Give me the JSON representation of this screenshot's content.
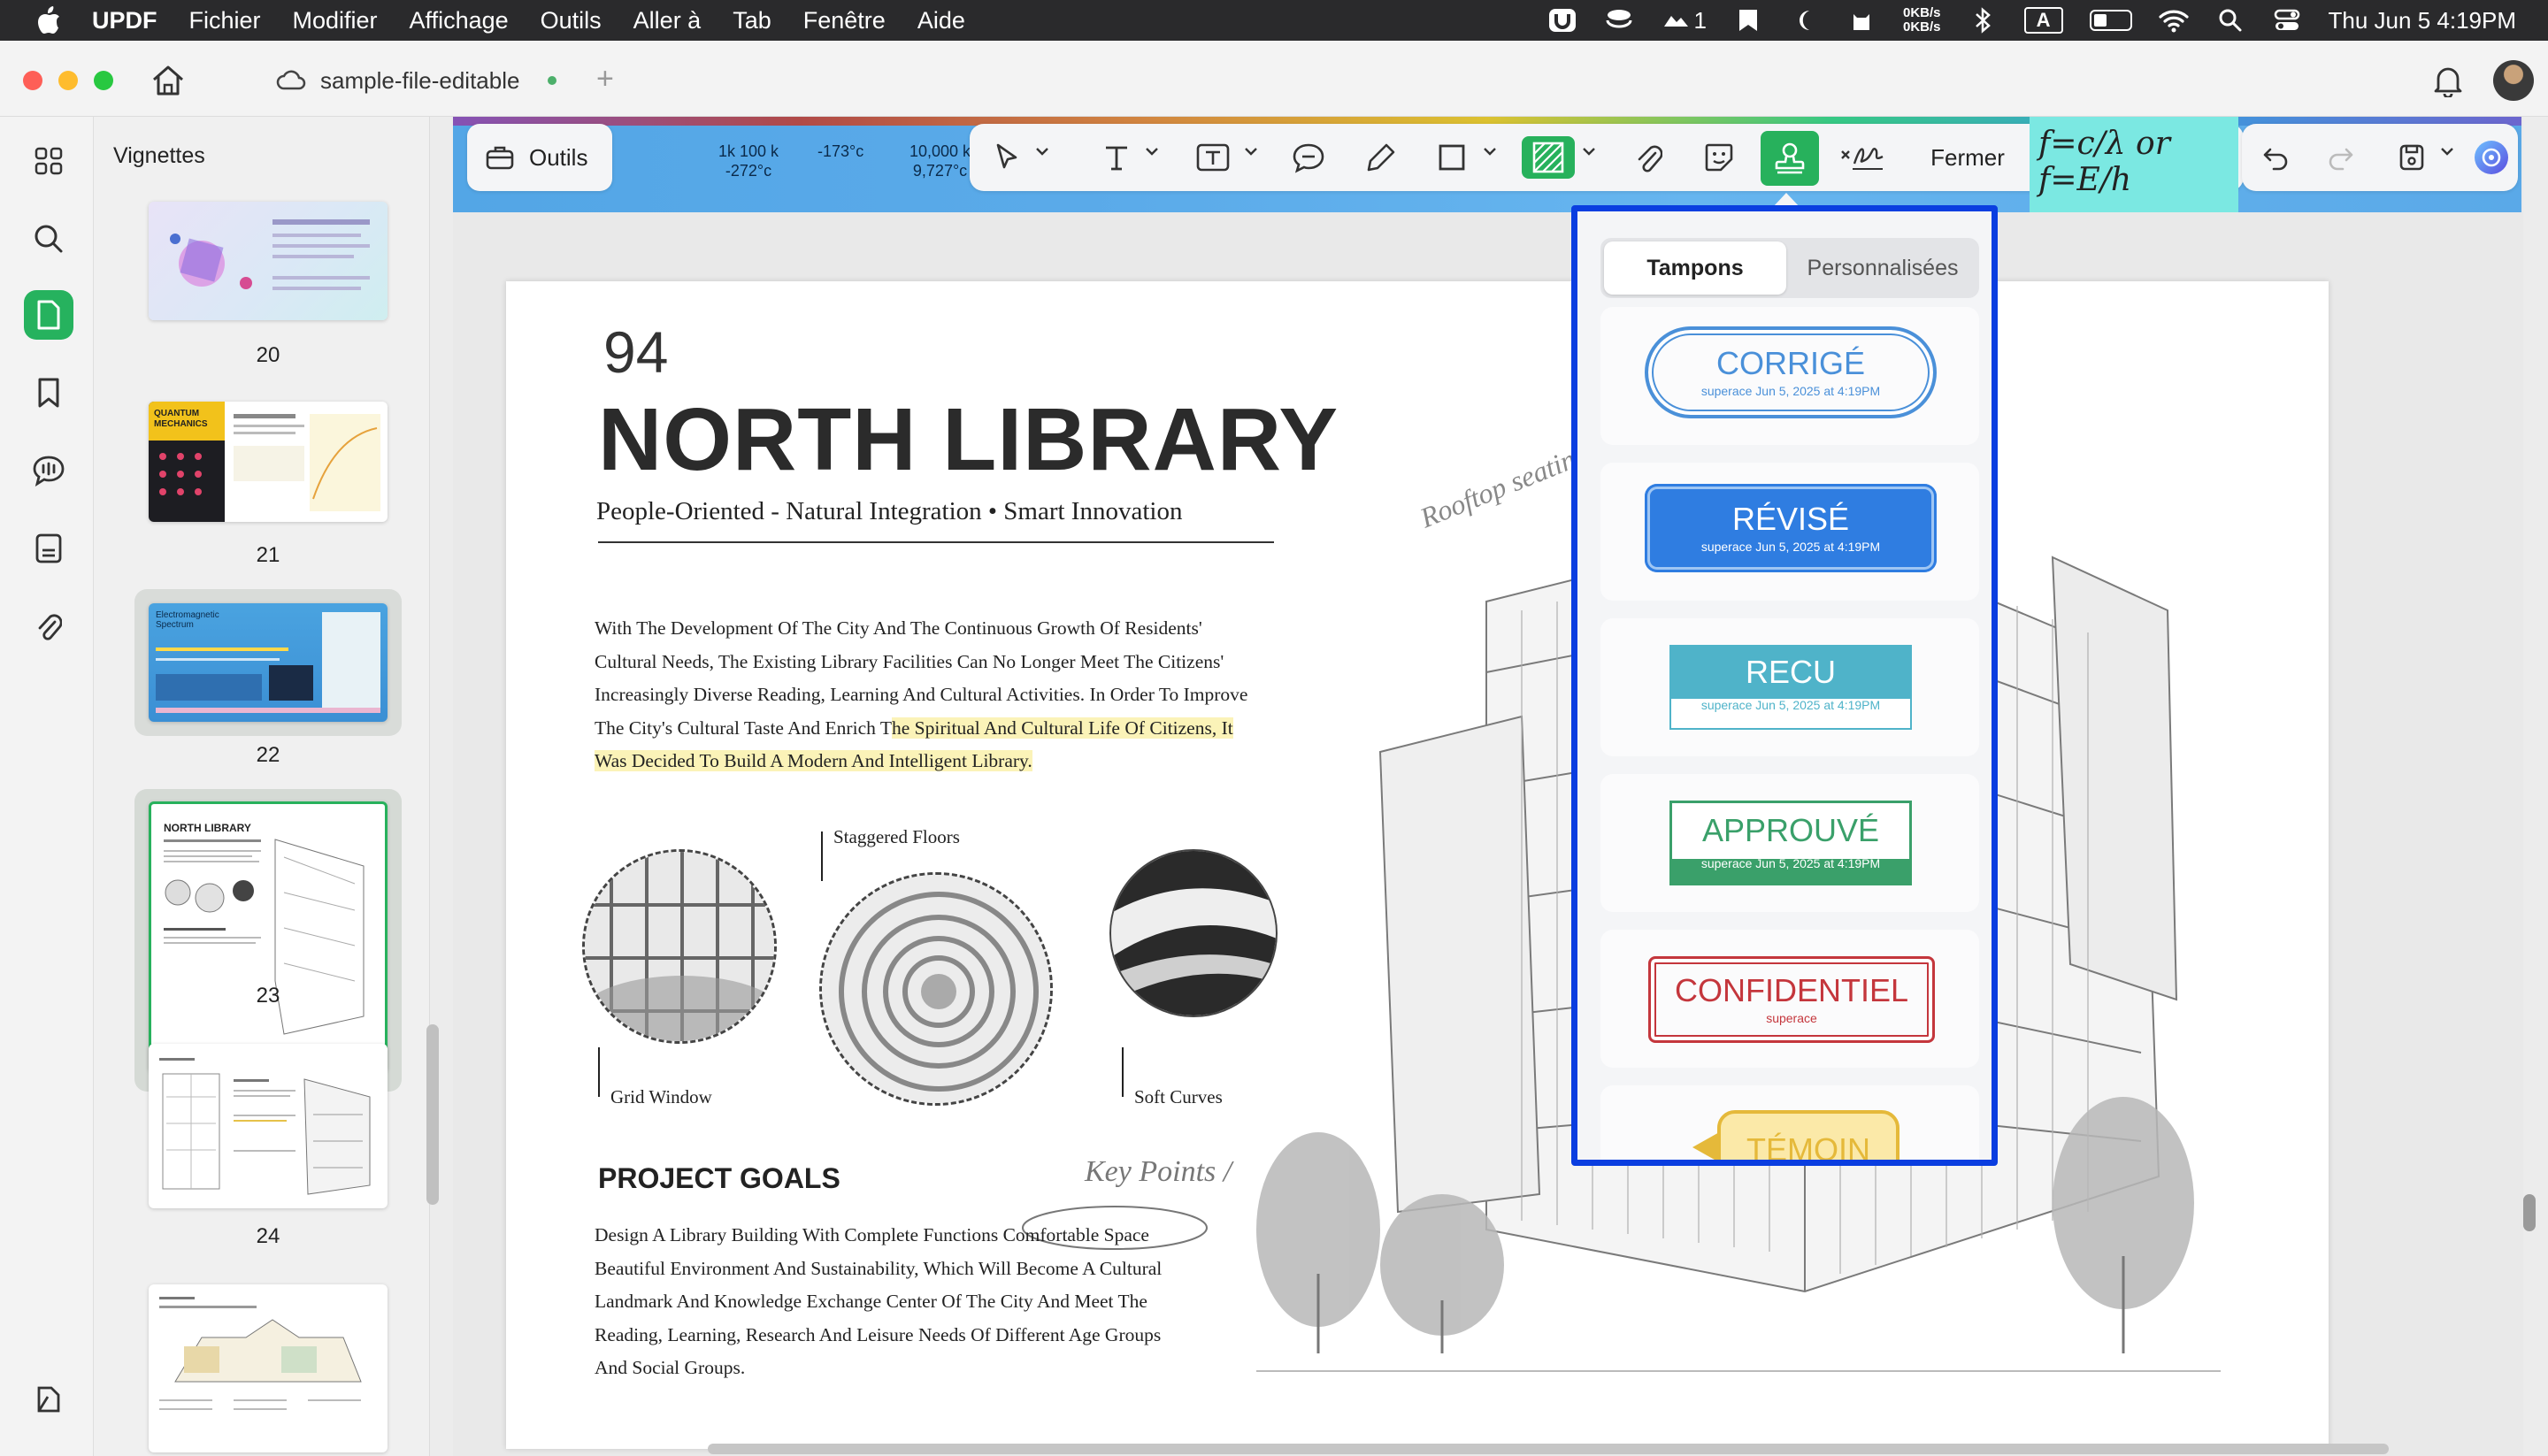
{
  "menubar": {
    "app": "UPDF",
    "items": [
      "Fichier",
      "Modifier",
      "Affichage",
      "Outils",
      "Aller à",
      "Tab",
      "Fenêtre",
      "Aide"
    ],
    "status": {
      "badge_count": "1",
      "net_up": "0KB/s",
      "net_down": "0KB/s",
      "input_source": "A",
      "datetime": "Thu Jun 5  4:19PM"
    }
  },
  "window": {
    "tab_title": "sample-file-editable",
    "add_tab": "+"
  },
  "sidebar": {
    "title": "Vignettes",
    "pages": [
      {
        "number": "20"
      },
      {
        "number": "21",
        "thumb_text": "QUANTUM MECHANICS"
      },
      {
        "number": "22",
        "thumb_text": "Electromagnetic Spectrum"
      },
      {
        "number": "23",
        "thumb_text": "NORTH LIBRARY",
        "selected": true
      },
      {
        "number": "24"
      }
    ]
  },
  "toolbar": {
    "outils_label": "Outils",
    "fermer_label": "Fermer",
    "strip_labels": [
      {
        "top": "1k 100 k",
        "bottom": "-272°c"
      },
      {
        "top": "",
        "bottom": "-173°c"
      },
      {
        "top": "10,000 k",
        "bottom": "9,727°c"
      }
    ],
    "formula": "f=c/λ or f=E/h"
  },
  "document": {
    "page_number": "94",
    "title": "NORTH LIBRARY",
    "subtitle": "People-Oriented - Natural Integration • Smart Innovation",
    "intro_lines": [
      "With The Development Of The City And The Continuous Growth Of Residents'",
      "Cultural Needs, The Existing Library Facilities Can No Longer Meet The Citizens'",
      "Increasingly Diverse Reading, Learning And Cultural Activities. In Order To Improve"
    ],
    "intro_line4_plain": "The City's Cultural Taste And Enrich T",
    "intro_line4_hl": "he Spiritual And Cultural Life Of Citizens, It",
    "intro_line5_hl": "Was Decided To Build A Modern And Intelligent Library.",
    "captions": {
      "grid": "Grid Window",
      "staggered": "Staggered Floors",
      "curves": "Soft Curves"
    },
    "rooftop": "Rooftop seatin",
    "goals_title": "PROJECT GOALS",
    "key_points": "Key Points /",
    "goals_lines": [
      "Design A Library Building With Complete Functions Comfortable Space",
      "Beautiful Environment And Sustainability, Which Will Become A Cultural",
      "Landmark And Knowledge Exchange Center Of The City And Meet The",
      "Reading, Learning, Research And Leisure Needs Of Different Age Groups",
      "And Social Groups."
    ]
  },
  "stamp_panel": {
    "tabs": [
      "Tampons",
      "Personnalisées"
    ],
    "active_tab": "Tampons",
    "stamps": [
      {
        "title": "CORRIGÉ",
        "sub": "superace Jun 5, 2025 at 4:19PM",
        "color": "#4a90d9"
      },
      {
        "title": "RÉVISÉ",
        "sub": "superace Jun 5, 2025 at 4:19PM",
        "color": "#2f7de1"
      },
      {
        "title": "RECU",
        "sub": "superace Jun 5, 2025 at 4:19PM",
        "color": "#4fb3c9"
      },
      {
        "title": "APPROUVÉ",
        "sub": "superace Jun 5, 2025 at 4:19PM",
        "color": "#3aa06a"
      },
      {
        "title": "CONFIDENTIEL",
        "sub": "superace",
        "color": "#c4363c"
      },
      {
        "title": "TÉMOIN",
        "sub": "",
        "color": "#e5b93a"
      }
    ]
  },
  "colors": {
    "accent_green": "#27b15c",
    "panel_border": "#0a3ee0"
  }
}
